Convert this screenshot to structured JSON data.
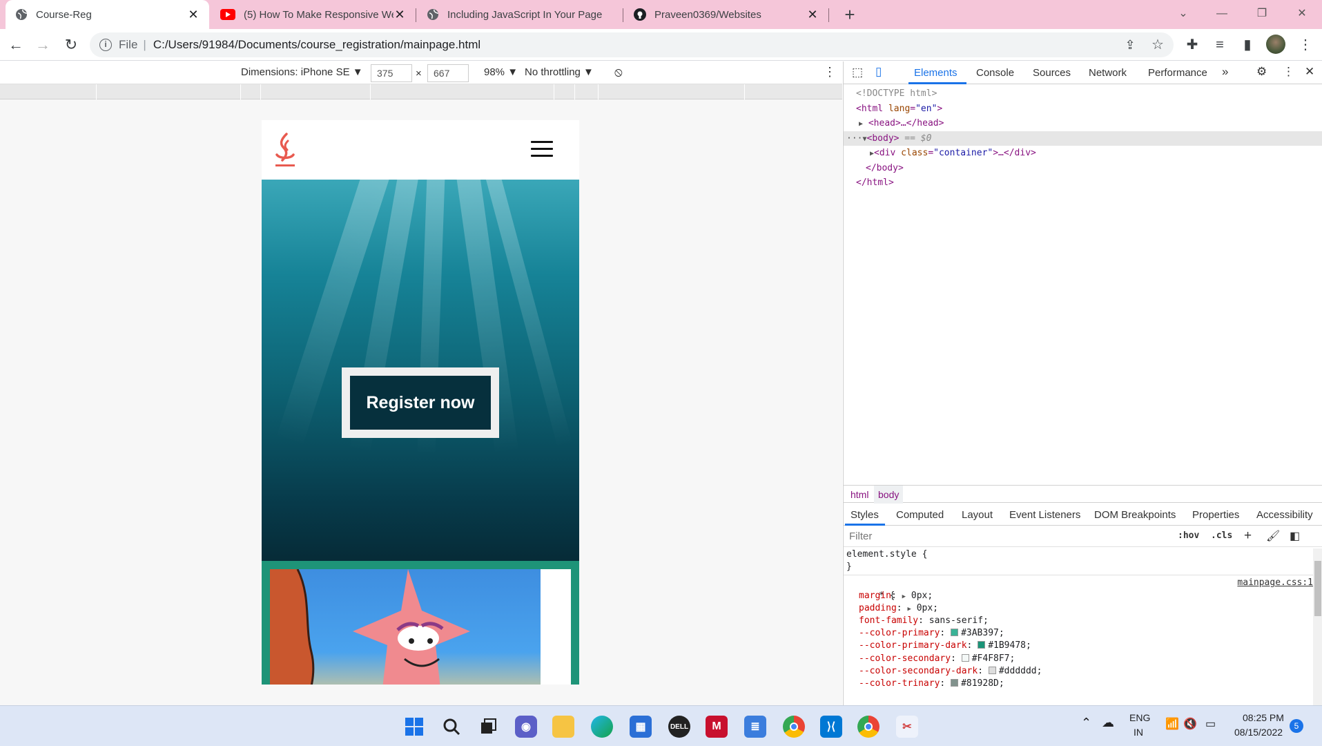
{
  "tabs": [
    {
      "title": "Course-Reg",
      "active": true,
      "favicon": "globe-icon"
    },
    {
      "title": "(5) How To Make Responsive We",
      "active": false,
      "favicon": "youtube-icon"
    },
    {
      "title": "Including JavaScript In Your Page",
      "active": false,
      "favicon": "globe-icon"
    },
    {
      "title": "Praveen0369/Websites",
      "active": false,
      "favicon": "github-icon"
    }
  ],
  "tab_close": "✕",
  "new_tab": "+",
  "window_controls": {
    "collapse": "⌄",
    "minimize": "—",
    "restore": "❐",
    "close": "✕"
  },
  "toolbar": {
    "file_label": "File",
    "url": "C:/Users/91984/Documents/course_registration/mainpage.html"
  },
  "device_toolbar": {
    "dimensions": "Dimensions: iPhone SE ▼",
    "width": "375",
    "times": "×",
    "height": "667",
    "zoom": "98% ▼",
    "throttling": "No throttling ▼",
    "more": "⋮"
  },
  "page": {
    "register_label": "Register now"
  },
  "devtools": {
    "tabs": [
      "Elements",
      "Console",
      "Sources",
      "Network",
      "Performance"
    ],
    "more_tabs": "»",
    "dom": {
      "doctype": "<!DOCTYPE html>",
      "html_open_tag": "<html",
      "html_lang_attr": "lang",
      "html_lang_val": "\"en\"",
      "html_open_close": ">",
      "head_line": "<head>…</head>",
      "body_line": "<body>",
      "body_eq": " == $0",
      "ellipsis": "···",
      "div_open": "<div",
      "div_class_attr": "class",
      "div_class_val": "\"container\"",
      "div_rest": ">…</div>",
      "body_close": "</body>",
      "html_close": "</html>"
    },
    "breadcrumbs": [
      "html",
      "body"
    ],
    "styles_tabs": [
      "Styles",
      "Computed",
      "Layout",
      "Event Listeners",
      "DOM Breakpoints",
      "Properties",
      "Accessibility"
    ],
    "filter_placeholder": "Filter",
    "hov": ":hov",
    "cls": ".cls",
    "add": "+",
    "element_style": "element.style {",
    "close_brace": "}",
    "universal_selector": "* {",
    "source_link": "mainpage.css:1",
    "properties": [
      {
        "name": "margin",
        "value": "0px;",
        "arrow": true
      },
      {
        "name": "padding",
        "value": "0px;",
        "arrow": true
      },
      {
        "name": "font-family",
        "value": "sans-serif;"
      },
      {
        "name": "--color-primary",
        "value": "#3AB397;",
        "swatch": "#3AB397"
      },
      {
        "name": "--color-primary-dark",
        "value": "#1B9478;",
        "swatch": "#1B9478"
      },
      {
        "name": "--color-secondary",
        "value": "#F4F8F7;",
        "swatch": "#F4F8F7"
      },
      {
        "name": "--color-secondary-dark",
        "value": "#dddddd;",
        "swatch": "#dddddd"
      },
      {
        "name": "--color-trinary",
        "value": "#81928D;",
        "swatch": "#81928D"
      }
    ]
  },
  "taskbar": {
    "lang_top": "ENG",
    "lang_bottom": "IN",
    "time": "08:25 PM",
    "date": "08/15/2022",
    "notifications": "5"
  }
}
